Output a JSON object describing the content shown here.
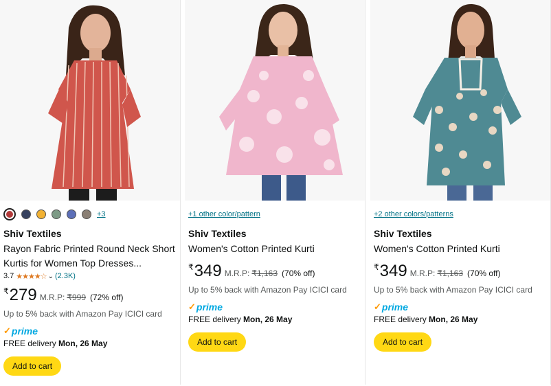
{
  "products": [
    {
      "brand": "Shiv Textiles",
      "title": "Rayon Fabric Printed Round Neck Short Kurtis for Women Top Dresses...",
      "rating_value": "3.7",
      "rating_stars": "★★★★☆",
      "rating_count": "(2.3K)",
      "rupee": "₹",
      "price": "279",
      "mrp_label": "M.R.P:",
      "mrp": "₹999",
      "discount": "(72% off)",
      "cashback": "Up to 5% back with Amazon Pay ICICI card",
      "prime_check": "✓",
      "prime_text": "prime",
      "delivery_label": "FREE delivery",
      "delivery_date": "Mon, 26 May",
      "add_to_cart": "Add to cart",
      "swatch_colors": [
        "#b23a3a",
        "#36415f",
        "#f2b233",
        "#7d9a86",
        "#5c6fb8",
        "#8a7f74"
      ],
      "more_swatches": "+3"
    },
    {
      "color_link": "+1 other color/pattern",
      "brand": "Shiv Textiles",
      "title": "Women's Cotton Printed Kurti",
      "rupee": "₹",
      "price": "349",
      "mrp_label": "M.R.P:",
      "mrp": "₹1,163",
      "discount": "(70% off)",
      "cashback": "Up to 5% back with Amazon Pay ICICI card",
      "prime_check": "✓",
      "prime_text": "prime",
      "delivery_label": "FREE delivery",
      "delivery_date": "Mon, 26 May",
      "add_to_cart": "Add to cart"
    },
    {
      "color_link": "+2 other colors/patterns",
      "brand": "Shiv Textiles",
      "title": "Women's Cotton Printed Kurti",
      "rupee": "₹",
      "price": "349",
      "mrp_label": "M.R.P:",
      "mrp": "₹1,163",
      "discount": "(70% off)",
      "cashback": "Up to 5% back with Amazon Pay ICICI card",
      "prime_check": "✓",
      "prime_text": "prime",
      "delivery_label": "FREE delivery",
      "delivery_date": "Mon, 26 May",
      "add_to_cart": "Add to cart"
    }
  ],
  "colors": {
    "accent_link": "#007185",
    "cart_button": "#ffd814",
    "prime_blue": "#00a8e1",
    "star": "#de7921"
  }
}
